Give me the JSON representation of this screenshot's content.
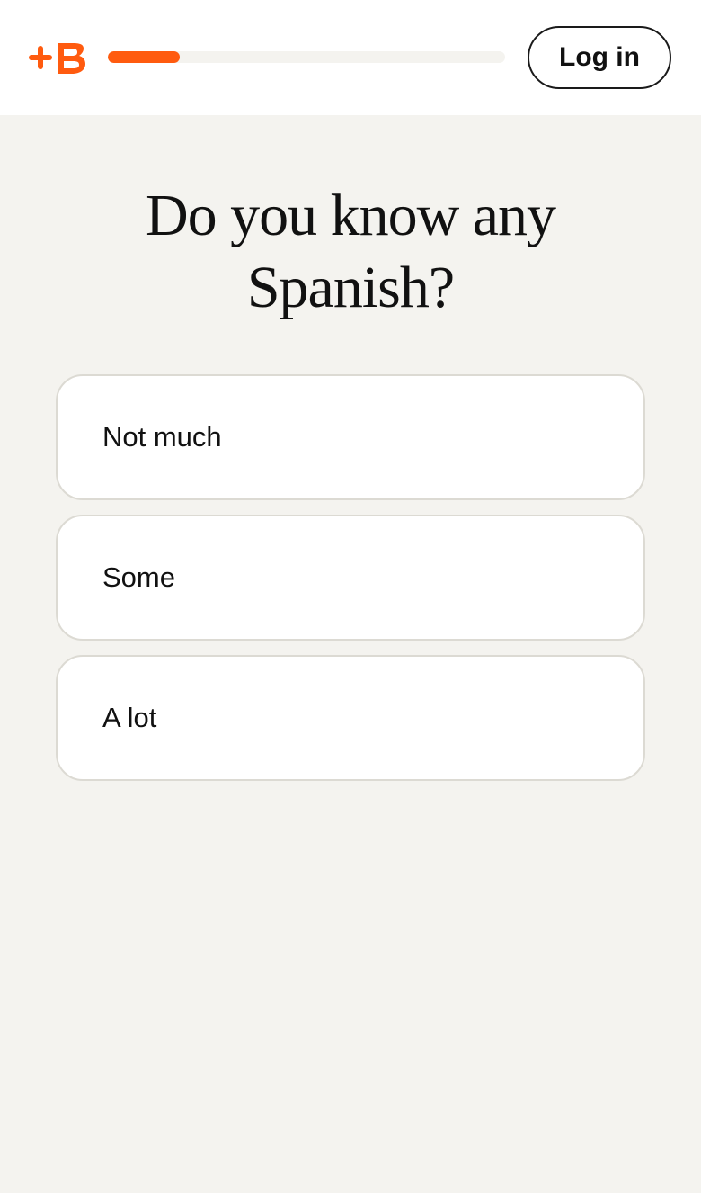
{
  "brand": {
    "logo_icon": "babbel-plus-b-logo",
    "accent_color": "#ff5b0f"
  },
  "header": {
    "progress_fraction": 0.18,
    "login_label": "Log in"
  },
  "main": {
    "question": "Do you know any Spanish?",
    "options": [
      {
        "label": "Not much"
      },
      {
        "label": "Some"
      },
      {
        "label": "A lot"
      }
    ]
  }
}
